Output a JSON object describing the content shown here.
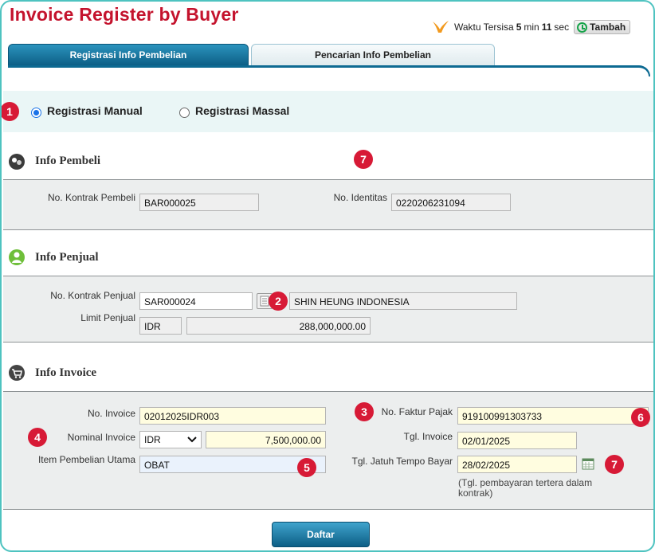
{
  "title": "Invoice Register by Buyer",
  "timer": {
    "prefix": "Waktu Tersisa",
    "minutes": "5",
    "min_label": "min",
    "seconds": "11",
    "sec_label": "sec",
    "add_label": "Tambah"
  },
  "tabs": [
    {
      "label": "Registrasi Info Pembelian",
      "active": true
    },
    {
      "label": "Pencarian Info Pembelian",
      "active": false
    }
  ],
  "registration": {
    "manual_label": "Registrasi Manual",
    "mass_label": "Registrasi Massal",
    "selected": "manual"
  },
  "badges": [
    "1",
    "2",
    "3",
    "4",
    "5",
    "6",
    "7"
  ],
  "buyer": {
    "heading": "Info Pembeli",
    "contract_label": "No. Kontrak Pembeli",
    "contract_value": "BAR000025",
    "id_label": "No. Identitas",
    "id_value": "0220206231094"
  },
  "seller": {
    "heading": "Info Penjual",
    "contract_label": "No. Kontrak Penjual",
    "contract_value": "SAR000024",
    "name_value": "SHIN HEUNG INDONESIA",
    "limit_label": "Limit Penjual",
    "limit_currency": "IDR",
    "limit_value": "288,000,000.00"
  },
  "invoice": {
    "heading": "Info Invoice",
    "no_label": "No. Invoice",
    "no_value": "02012025IDR003",
    "nominal_label": "Nominal Invoice",
    "currency": "IDR",
    "nominal_value": "7,500,000.00",
    "item_label": "Item Pembelian Utama",
    "item_value": "OBAT",
    "tax_label": "No. Faktur Pajak",
    "tax_value": "919100991303733",
    "date_label": "Tgl. Invoice",
    "date_value": "02/01/2025",
    "due_label": "Tgl. Jatuh Tempo Bayar",
    "due_value": "28/02/2025",
    "due_note": "(Tgl. pembayaran tertera dalam kontrak)"
  },
  "submit_label": "Daftar",
  "colors": {
    "title": "#c4132d",
    "badge": "#d71a36",
    "tab_active": "#0d5f86",
    "frame": "#4ec3c0"
  }
}
